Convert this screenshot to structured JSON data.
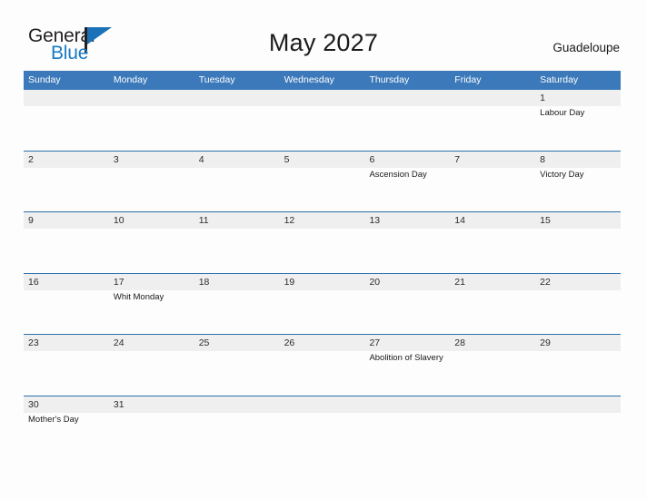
{
  "brand": {
    "name_part1": "General",
    "name_part2": "Blue",
    "flag_icon": "flag-icon",
    "accent_color": "#1a7ac4"
  },
  "header": {
    "title": "May 2027",
    "location": "Guadeloupe"
  },
  "calendar": {
    "header_bg_color": "#3b79ba",
    "row_line_color": "#2a6fab",
    "date_band_color": "#efefef",
    "day_names": [
      "Sunday",
      "Monday",
      "Tuesday",
      "Wednesday",
      "Thursday",
      "Friday",
      "Saturday"
    ],
    "weeks": [
      {
        "days": [
          {
            "num": "",
            "event": ""
          },
          {
            "num": "",
            "event": ""
          },
          {
            "num": "",
            "event": ""
          },
          {
            "num": "",
            "event": ""
          },
          {
            "num": "",
            "event": ""
          },
          {
            "num": "",
            "event": ""
          },
          {
            "num": "1",
            "event": "Labour Day"
          }
        ]
      },
      {
        "days": [
          {
            "num": "2",
            "event": ""
          },
          {
            "num": "3",
            "event": ""
          },
          {
            "num": "4",
            "event": ""
          },
          {
            "num": "5",
            "event": ""
          },
          {
            "num": "6",
            "event": "Ascension Day"
          },
          {
            "num": "7",
            "event": ""
          },
          {
            "num": "8",
            "event": "Victory Day"
          }
        ]
      },
      {
        "days": [
          {
            "num": "9",
            "event": ""
          },
          {
            "num": "10",
            "event": ""
          },
          {
            "num": "11",
            "event": ""
          },
          {
            "num": "12",
            "event": ""
          },
          {
            "num": "13",
            "event": ""
          },
          {
            "num": "14",
            "event": ""
          },
          {
            "num": "15",
            "event": ""
          }
        ]
      },
      {
        "days": [
          {
            "num": "16",
            "event": ""
          },
          {
            "num": "17",
            "event": "Whit Monday"
          },
          {
            "num": "18",
            "event": ""
          },
          {
            "num": "19",
            "event": ""
          },
          {
            "num": "20",
            "event": ""
          },
          {
            "num": "21",
            "event": ""
          },
          {
            "num": "22",
            "event": ""
          }
        ]
      },
      {
        "days": [
          {
            "num": "23",
            "event": ""
          },
          {
            "num": "24",
            "event": ""
          },
          {
            "num": "25",
            "event": ""
          },
          {
            "num": "26",
            "event": ""
          },
          {
            "num": "27",
            "event": "Abolition of Slavery"
          },
          {
            "num": "28",
            "event": ""
          },
          {
            "num": "29",
            "event": ""
          }
        ]
      },
      {
        "days": [
          {
            "num": "30",
            "event": "Mother's Day"
          },
          {
            "num": "31",
            "event": ""
          },
          {
            "num": "",
            "event": ""
          },
          {
            "num": "",
            "event": ""
          },
          {
            "num": "",
            "event": ""
          },
          {
            "num": "",
            "event": ""
          },
          {
            "num": "",
            "event": ""
          }
        ]
      }
    ]
  }
}
